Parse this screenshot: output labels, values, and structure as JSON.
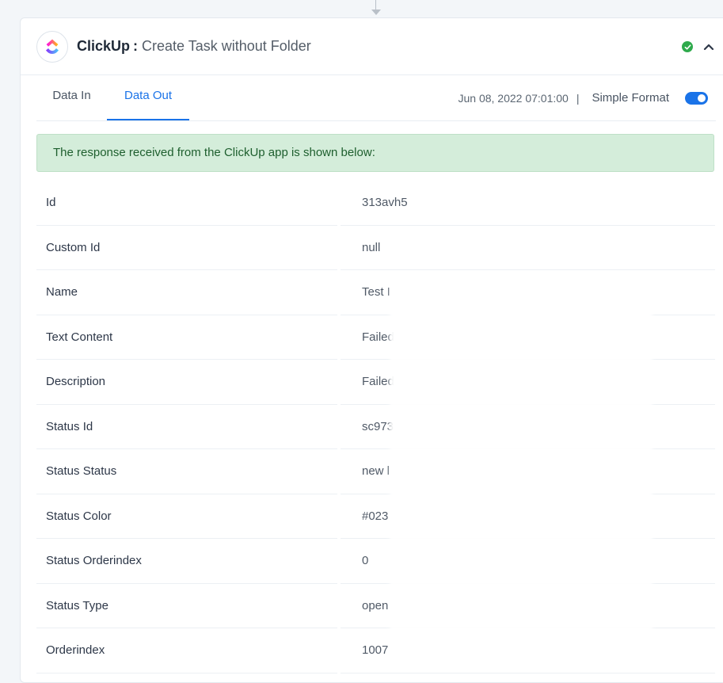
{
  "header": {
    "app_name": "ClickUp",
    "separator": ":",
    "action_title": "Create Task without Folder",
    "logo_icon": "clickup-logo-icon",
    "status_icon": "check-circle-icon",
    "collapse_icon": "chevron-up-icon",
    "status_color": "#2eaa4c"
  },
  "tabs": [
    {
      "label": "Data In",
      "active": false
    },
    {
      "label": "Data Out",
      "active": true
    }
  ],
  "meta": {
    "timestamp": "Jun 08, 2022 07:01:00",
    "divider": "|",
    "format_label": "Simple Format",
    "format_toggle_on": true
  },
  "alert": {
    "message": "The response received from the ClickUp app is shown below:"
  },
  "rows": [
    {
      "key": "Id",
      "value": "313avh5"
    },
    {
      "key": "Custom Id",
      "value": "null"
    },
    {
      "key": "Name",
      "value": "Test I"
    },
    {
      "key": "Text Content",
      "value": "Failed"
    },
    {
      "key": "Description",
      "value": "Failed"
    },
    {
      "key": "Status Id",
      "value": "sc973"
    },
    {
      "key": "Status Status",
      "value": "new l"
    },
    {
      "key": "Status Color",
      "value": "#023"
    },
    {
      "key": "Status Orderindex",
      "value": "0"
    },
    {
      "key": "Status Type",
      "value": "open"
    },
    {
      "key": "Orderindex",
      "value": "1007"
    }
  ],
  "colors": {
    "accent": "#1a73e8",
    "success_bg": "#d4edda",
    "success_text": "#1e5f2e"
  }
}
